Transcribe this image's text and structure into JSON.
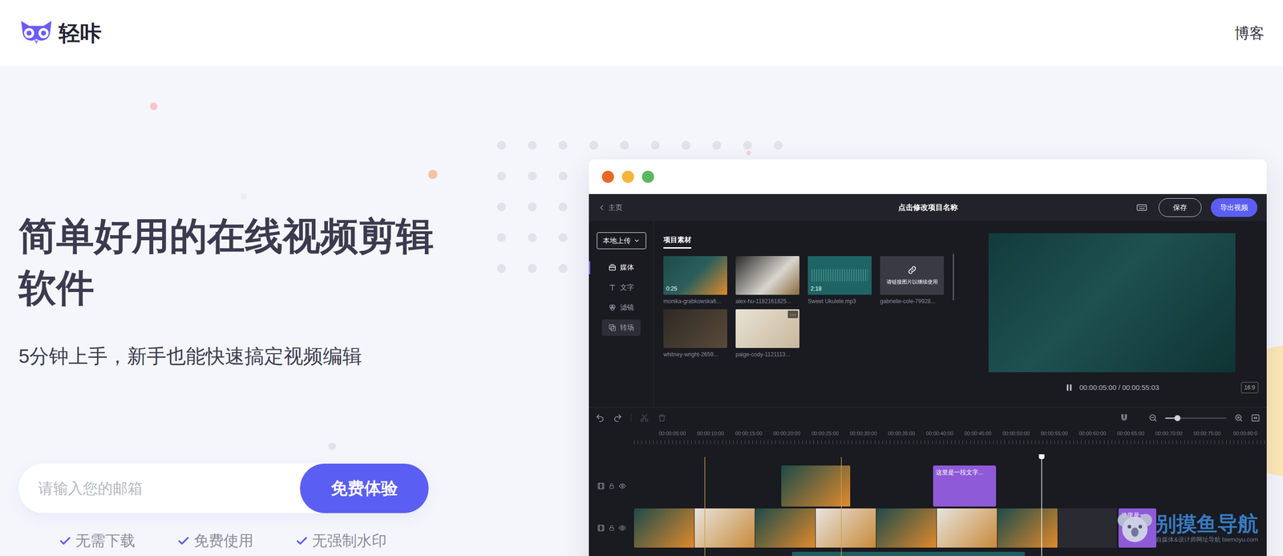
{
  "header": {
    "logo": "轻咔",
    "nav": [
      {
        "label": "博客"
      }
    ]
  },
  "hero": {
    "title": "简单好用的在线视频剪辑软件",
    "subtitle": "5分钟上手，新手也能快速搞定视频编辑",
    "email": {
      "placeholder": "请输入您的邮箱"
    },
    "cta": "免费体验",
    "features": [
      "无需下载",
      "免费使用",
      "无强制水印"
    ]
  },
  "app": {
    "window": {
      "controls": [
        {
          "color": "#e8692a"
        },
        {
          "color": "#f5b53b"
        },
        {
          "color": "#5cb85c"
        }
      ]
    },
    "topbar": {
      "back": "主页",
      "project_name": "点击修改项目名称",
      "save": "保存",
      "export": "导出视频"
    },
    "upload": "本地上传",
    "sidebar": {
      "items": [
        {
          "label": "媒体",
          "selected": true,
          "highlighted": false
        },
        {
          "label": "文字",
          "selected": false,
          "highlighted": false
        },
        {
          "label": "滤镜",
          "selected": false,
          "highlighted": false
        },
        {
          "label": "转场",
          "selected": false,
          "highlighted": true
        }
      ]
    },
    "assets": {
      "tab": "项目素材",
      "items": [
        {
          "kind": "video",
          "name": "monika-grabkowska6...",
          "duration": "0:25"
        },
        {
          "kind": "image",
          "name": "alex-hu-1182161825..."
        },
        {
          "kind": "audio",
          "name": "Sweet Ukulele.mp3",
          "duration": "2:18"
        },
        {
          "kind": "missing",
          "name": "gabrielle-cole-79928...",
          "notice": "请链接图片以继续使用"
        },
        {
          "kind": "image",
          "name": "whitney-wright-2659..."
        },
        {
          "kind": "image",
          "name": "paige-cody-1121113...",
          "menu": "···"
        }
      ]
    },
    "preview": {
      "playing": true,
      "time": "00:00:05:00 / 00:00:55:03",
      "ratio": "16:9"
    },
    "timeline": {
      "zoom": {
        "level": 0.2
      },
      "ruler": [
        "00:00:05:00",
        "00:00:10:00",
        "00:00:15:00",
        "00:00:20:00",
        "00:00:25:00",
        "00:00:30:00",
        "00:00:35:00",
        "00:00:40:00",
        "00:00:45:00",
        "00:00:50:00",
        "00:00:55:00",
        "00:00:60:00",
        "00:00:65:00",
        "00:00:70:00",
        "00:00:75:00",
        "00:00:80:0"
      ],
      "tracks": [
        {
          "clips": [
            {
              "kind": "media"
            },
            {
              "kind": "text",
              "label": "这里是一段文字..."
            }
          ]
        },
        {
          "clips": [
            {
              "kind": "media"
            },
            {
              "kind": "text",
              "label": "这里是一..."
            }
          ]
        },
        {
          "clips": [
            {
              "kind": "audio"
            }
          ]
        }
      ]
    }
  },
  "watermark": {
    "title": "别摸鱼导航",
    "subtitle": "自媒体&设计师网址导航 biemoyu.com"
  }
}
